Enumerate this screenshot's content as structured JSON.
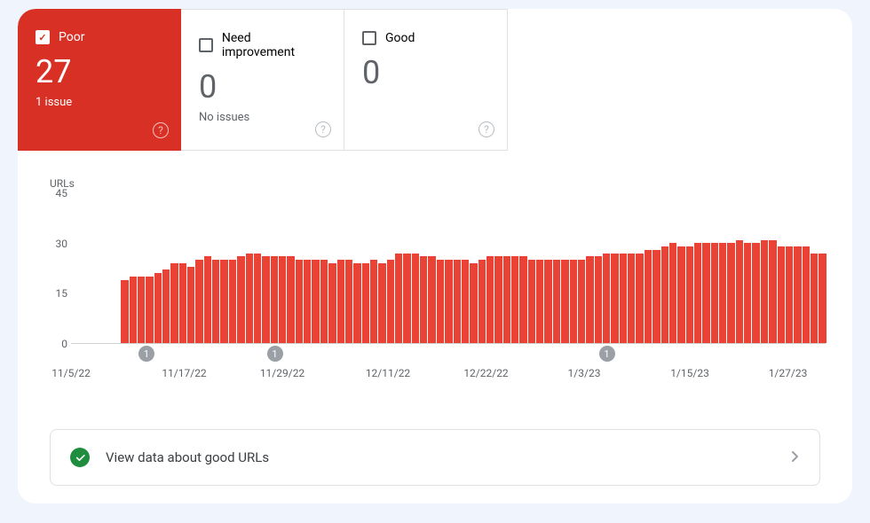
{
  "tabs": [
    {
      "label": "Poor",
      "count": "27",
      "sub": "1 issue",
      "active": true
    },
    {
      "label": "Need improvement",
      "count": "0",
      "sub": "No issues",
      "active": false
    },
    {
      "label": "Good",
      "count": "0",
      "sub": "",
      "active": false
    }
  ],
  "goodUrls": {
    "label": "View data about good URLs"
  },
  "chart_data": {
    "type": "bar",
    "title": "",
    "ylabel": "URLs",
    "xlabel": "",
    "ylim": [
      0,
      45
    ],
    "y_ticks": [
      0,
      15,
      30,
      45
    ],
    "x_tick_labels": [
      "11/5/22",
      "11/17/22",
      "11/29/22",
      "12/11/22",
      "12/22/22",
      "1/3/23",
      "1/15/23",
      "1/27/23"
    ],
    "x_tick_positions": [
      0,
      15,
      28,
      42,
      55,
      68,
      82,
      95
    ],
    "markers": [
      {
        "label": "1",
        "position": 10
      },
      {
        "label": "1",
        "position": 27
      },
      {
        "label": "1",
        "position": 71
      }
    ],
    "values": [
      0,
      0,
      0,
      0,
      0,
      0,
      19,
      20,
      20,
      20,
      21,
      22,
      24,
      24,
      23,
      25,
      26,
      25,
      25,
      25,
      26,
      27,
      27,
      26,
      26,
      26,
      26,
      25,
      25,
      25,
      25,
      24,
      25,
      25,
      24,
      24,
      25,
      24,
      25,
      27,
      27,
      27,
      26,
      26,
      25,
      25,
      25,
      25,
      24,
      25,
      26,
      26,
      26,
      26,
      26,
      25,
      25,
      25,
      25,
      25,
      25,
      25,
      26,
      26,
      27,
      27,
      27,
      27,
      27,
      28,
      28,
      29,
      30,
      29,
      29,
      30,
      30,
      30,
      30,
      30,
      31,
      30,
      30,
      31,
      31,
      29,
      29,
      29,
      29,
      27,
      27
    ],
    "series": [
      {
        "name": "Poor",
        "color": "#ea4335"
      }
    ]
  }
}
